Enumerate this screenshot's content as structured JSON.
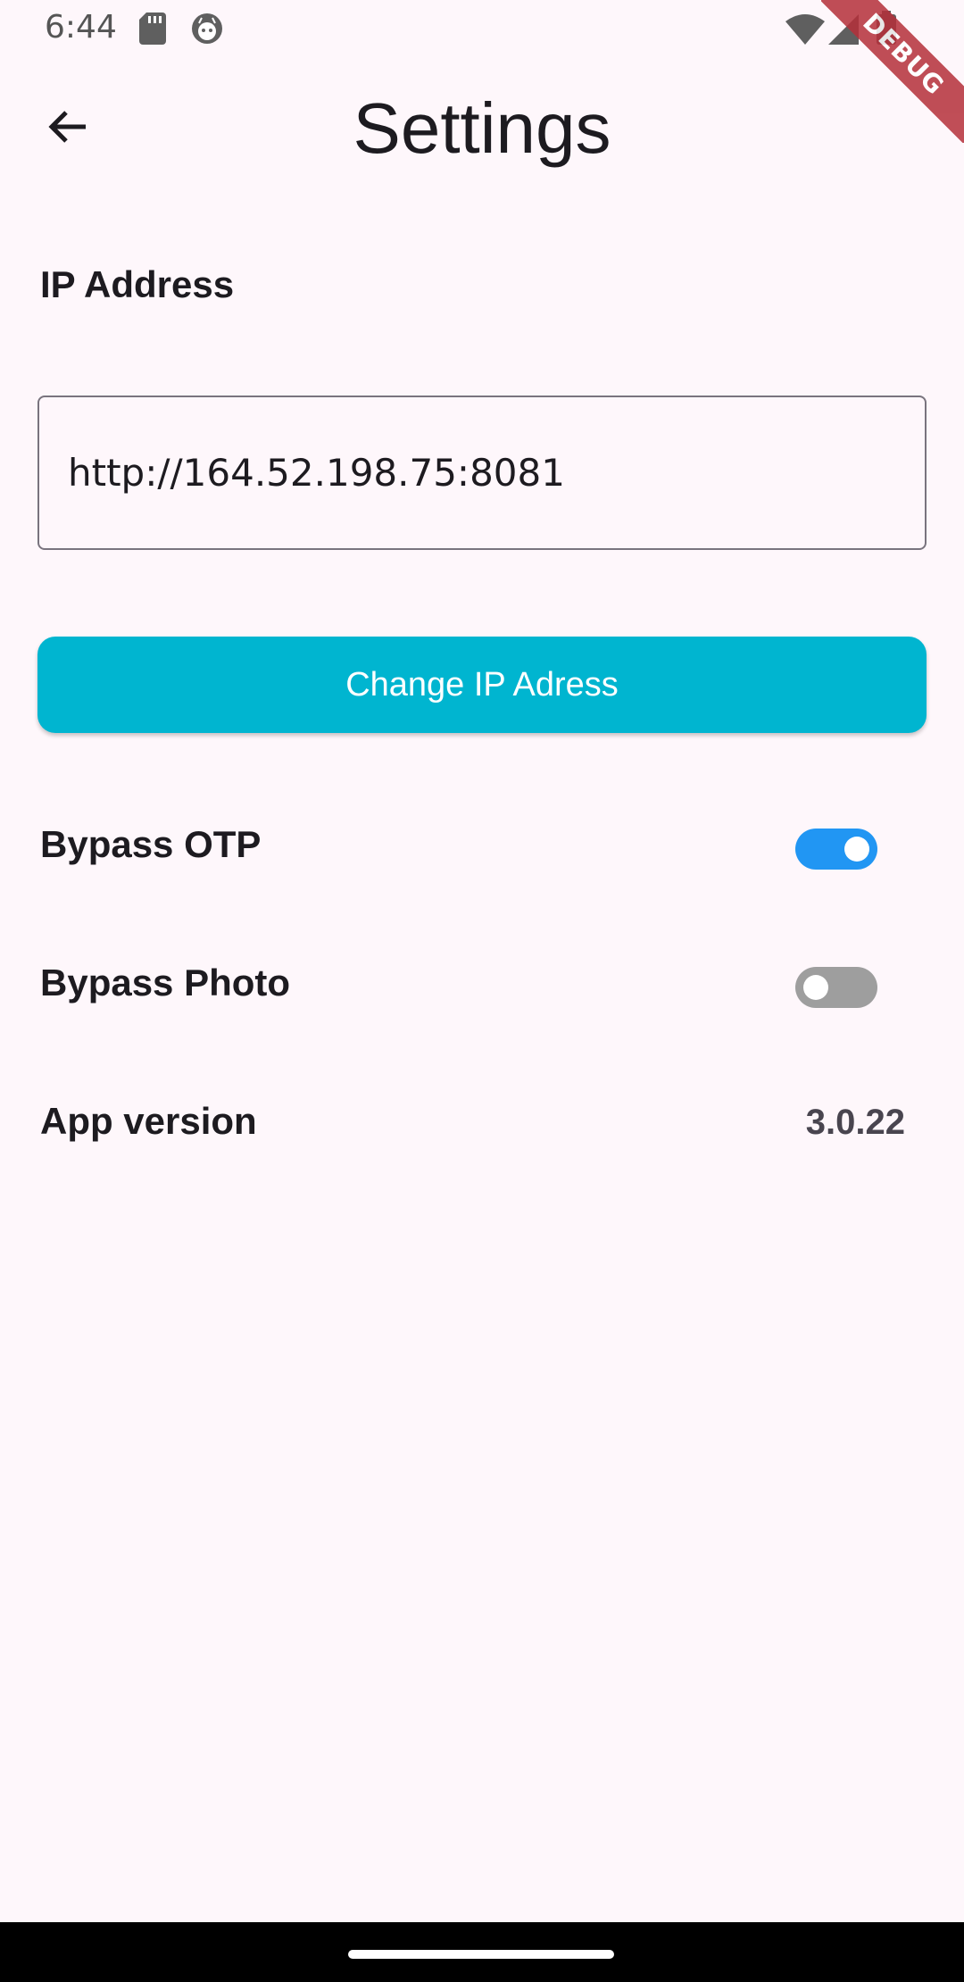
{
  "status_bar": {
    "time": "6:44",
    "left_icons": [
      "sd-card-icon",
      "android-face-icon"
    ],
    "right_icons": [
      "wifi-icon",
      "cellular-signal-icon",
      "battery-icon"
    ]
  },
  "debug_banner": {
    "label": "DEBUG",
    "color": "#B5303A"
  },
  "app_bar": {
    "back_icon": "arrow-back-icon",
    "title": "Settings"
  },
  "ip_section": {
    "label": "IP Address",
    "value": "http://164.52.198.75:8081"
  },
  "change_button": {
    "label": "Change IP Adress",
    "color": "#00B5D0"
  },
  "settings": {
    "bypass_otp": {
      "label": "Bypass OTP",
      "enabled": true
    },
    "bypass_photo": {
      "label": "Bypass Photo",
      "enabled": false
    },
    "app_version": {
      "label": "App version",
      "value": "3.0.22"
    }
  },
  "colors": {
    "background": "#FEF7FB",
    "toggle_on": "#2196F3",
    "toggle_off": "#9E9E9E"
  }
}
